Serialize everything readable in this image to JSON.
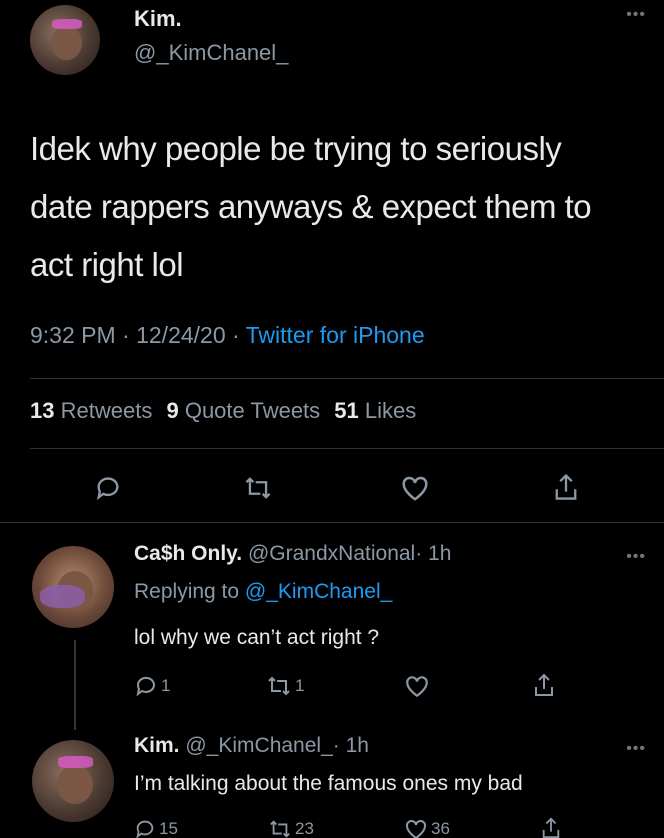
{
  "main_tweet": {
    "author_name": "Kim.",
    "author_handle": "@_KimChanel_",
    "more": "•••",
    "text_lines": [
      "Idek why people be trying to seriously",
      "date rappers anyways & expect them to",
      "act right lol"
    ],
    "time_date": "9:32 PM · 12/24/20 · ",
    "source": "Twitter for iPhone",
    "stats": {
      "retweets_count": "13",
      "retweets_label": "Retweets",
      "quotes_count": "9",
      "quotes_label": "Quote Tweets",
      "likes_count": "51",
      "likes_label": "Likes"
    }
  },
  "replies": [
    {
      "author_name": "Ca$h Only.",
      "author_handle": "@GrandxNational",
      "time": "· 1h",
      "replying_prefix": "Replying to ",
      "replying_to": "@_KimChanel_",
      "text": "lol why we can’t act right ?",
      "reply_count": "1",
      "retweet_count": "1",
      "like_count": ""
    },
    {
      "author_name": "Kim.",
      "author_handle": "@_KimChanel_",
      "time": "· 1h",
      "text": "I’m talking about the famous ones my bad",
      "reply_count": "15",
      "retweet_count": "23",
      "like_count": "36"
    }
  ],
  "icons": [
    "reply-icon",
    "retweet-icon",
    "like-icon",
    "share-icon",
    "more-icon"
  ],
  "colors": {
    "background": "#000000",
    "text": "#e7e9ea",
    "secondary": "#8b98a5",
    "accent": "#1d9bf0"
  }
}
